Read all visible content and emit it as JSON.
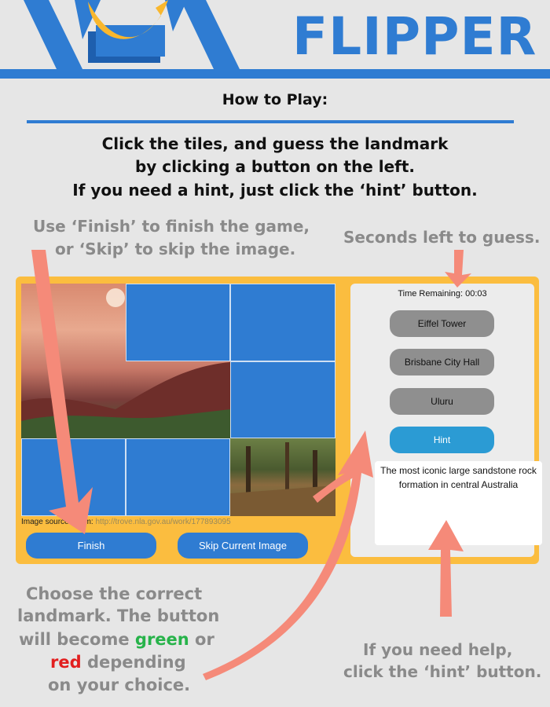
{
  "brand": {
    "title": "FLIPPER"
  },
  "how_to_play": {
    "heading": "How to Play:",
    "line1": "Click the tiles, and guess the landmark",
    "line2": "by clicking a button on the left.",
    "line3": "If you need a hint, just click the ‘hint’ button."
  },
  "notes": {
    "finish_line1": "Use ‘Finish’ to finish the game,",
    "finish_line2": "or ‘Skip’ to skip the image.",
    "seconds": "Seconds left to guess.",
    "choose_line1": "Choose the correct",
    "choose_line2": "landmark. The button",
    "choose_line3_a": "will become",
    "choose_green": "green",
    "choose_or": "or",
    "choose_red": "red",
    "choose_line4_b": "depending",
    "choose_line5": "on your choice.",
    "help_line1": "If you need help,",
    "help_line2": "click the ‘hint’ button."
  },
  "game": {
    "source_label": "Image sourced from:",
    "source_url": "http://trove.nla.gov.au/work/177893095",
    "finish_label": "Finish",
    "skip_label": "Skip Current Image",
    "time_remaining": "Time Remaining: 00:03",
    "options": [
      "Eiffel Tower",
      "Brisbane City Hall",
      "Uluru"
    ],
    "hint_label": "Hint",
    "hint_text": "The most iconic large sandstone rock formation in central Australia"
  },
  "colors": {
    "brand_blue": "#2f7cd2",
    "panel_orange": "#fbbd3f",
    "arrow_salmon": "#f58a79",
    "hint_blue": "#2b9bd4",
    "correct_green": "#27b34a",
    "wrong_red": "#e21f1f"
  }
}
